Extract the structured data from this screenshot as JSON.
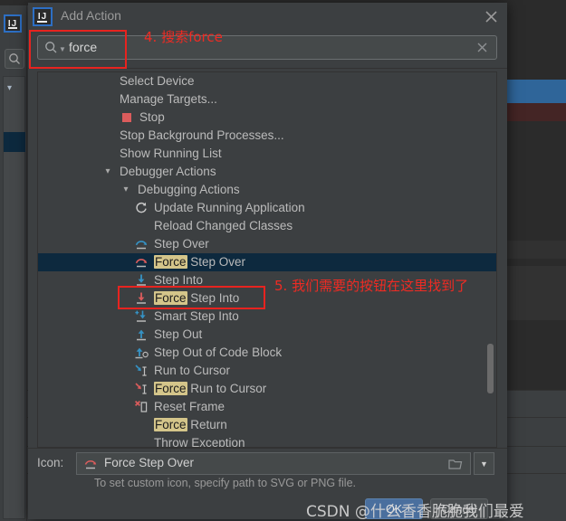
{
  "dialog": {
    "title": "Add Action",
    "app_icon": "intellij-idea-icon",
    "close_icon": "close-icon"
  },
  "search": {
    "value": "force",
    "placeholder": "",
    "search_icon": "search-icon",
    "clear_icon": "clear-icon"
  },
  "list": {
    "rows": [
      {
        "label": "Select Device",
        "indent": 90,
        "icon": "none",
        "twisty": "",
        "highlight": "",
        "selected": false
      },
      {
        "label": "Manage Targets...",
        "indent": 90,
        "icon": "none",
        "twisty": "",
        "highlight": "",
        "selected": false
      },
      {
        "label": "Stop",
        "indent": 112,
        "icon": "stop-square-icon",
        "twisty": "",
        "highlight": "",
        "selected": false
      },
      {
        "label": "Stop Background Processes...",
        "indent": 90,
        "icon": "none",
        "twisty": "",
        "highlight": "",
        "selected": false
      },
      {
        "label": "Show Running List",
        "indent": 90,
        "icon": "none",
        "twisty": "",
        "highlight": "",
        "selected": false
      },
      {
        "label": "Debugger Actions",
        "indent": 90,
        "icon": "none",
        "twisty": "v",
        "highlight": "",
        "selected": false
      },
      {
        "label": "Debugging Actions",
        "indent": 110,
        "icon": "none",
        "twisty": "v",
        "highlight": "",
        "selected": false
      },
      {
        "label": "Update Running Application",
        "indent": 128,
        "icon": "refresh-icon",
        "twisty": "",
        "highlight": "",
        "selected": false
      },
      {
        "label": "Reload Changed Classes",
        "indent": 128,
        "icon": "none",
        "twisty": "",
        "highlight": "",
        "selected": false
      },
      {
        "label": "Step Over",
        "indent": 128,
        "icon": "step-over-blue-icon",
        "twisty": "",
        "highlight": "",
        "selected": false
      },
      {
        "label": "Step Over",
        "indent": 128,
        "icon": "step-over-red-icon",
        "twisty": "",
        "highlight": "Force",
        "selected": true
      },
      {
        "label": "Step Into",
        "indent": 128,
        "icon": "step-into-blue-icon",
        "twisty": "",
        "highlight": "",
        "selected": false
      },
      {
        "label": "Step Into",
        "indent": 128,
        "icon": "step-into-red-icon",
        "twisty": "",
        "highlight": "Force",
        "selected": false
      },
      {
        "label": "Smart Step Into",
        "indent": 128,
        "icon": "smart-step-into-icon",
        "twisty": "",
        "highlight": "",
        "selected": false
      },
      {
        "label": "Step Out",
        "indent": 128,
        "icon": "step-out-icon",
        "twisty": "",
        "highlight": "",
        "selected": false
      },
      {
        "label": "Step Out of Code Block",
        "indent": 128,
        "icon": "step-out-block-icon",
        "twisty": "",
        "highlight": "",
        "selected": false
      },
      {
        "label": "Run to Cursor",
        "indent": 128,
        "icon": "run-to-cursor-icon",
        "twisty": "",
        "highlight": "",
        "selected": false
      },
      {
        "label": "Run to Cursor",
        "indent": 128,
        "icon": "force-run-cursor-icon",
        "twisty": "",
        "highlight": "Force",
        "selected": false
      },
      {
        "label": "Reset Frame",
        "indent": 128,
        "icon": "reset-frame-icon",
        "twisty": "",
        "highlight": "",
        "selected": false
      },
      {
        "label": "Return",
        "indent": 128,
        "icon": "none",
        "twisty": "",
        "highlight": "Force",
        "selected": false
      },
      {
        "label": "Throw Exception",
        "indent": 128,
        "icon": "none",
        "twisty": "",
        "highlight": "",
        "selected": false
      }
    ]
  },
  "icon_field": {
    "label": "Icon:",
    "value": "Force Step Over",
    "value_icon": "step-over-red-icon",
    "browse_icon": "folder-icon",
    "dropdown_icon": "chevron-down-icon",
    "hint": "To set custom icon, specify path to SVG or PNG file."
  },
  "buttons": {
    "ok": "OK",
    "cancel": "Cancel"
  },
  "annotations": [
    {
      "id": "a4",
      "text": "4. 搜索force"
    },
    {
      "id": "a5",
      "text": "5. 我们需要的按钮在这里找到了"
    }
  ],
  "watermark": "CSDN @什么香香脆脆我们最爱",
  "colors": {
    "dialog_bg": "#3c3f41",
    "selection_bg": "#0d293e",
    "highlight_bg": "#d4c58a",
    "annotation_red": "#ef2b23",
    "accent_blue": "#4a6f9e",
    "icon_blue": "#3592c4",
    "icon_red": "#db5c5c"
  }
}
